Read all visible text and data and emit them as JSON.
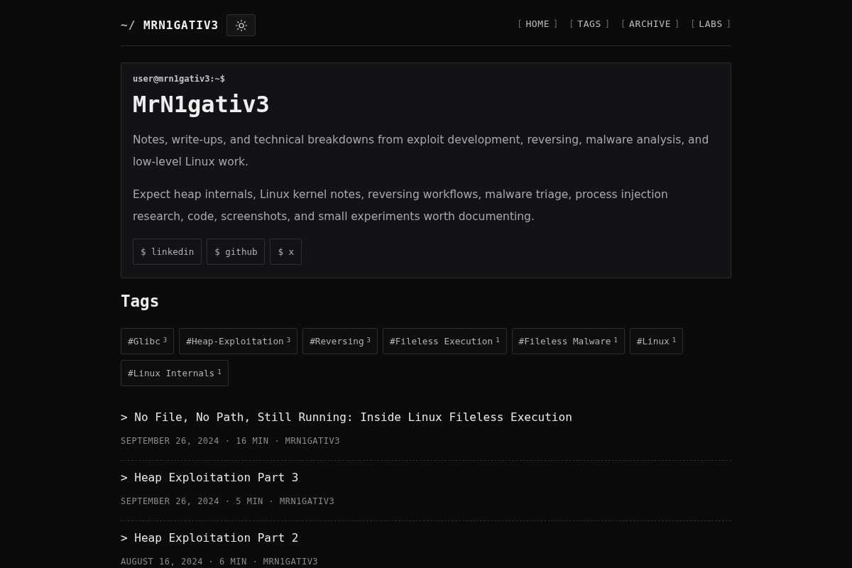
{
  "header": {
    "logo": {
      "prefix": "~/",
      "name": "MRN1GATIV3"
    },
    "nav": [
      {
        "open": "[",
        "label": "HOME",
        "close": "]"
      },
      {
        "open": "[",
        "label": "TAGS",
        "close": "]"
      },
      {
        "open": "[",
        "label": "ARCHIVE",
        "close": "]"
      },
      {
        "open": "[",
        "label": "LABS",
        "close": "]"
      }
    ]
  },
  "hero": {
    "prompt": "user@mrn1gativ3:~$",
    "title": "MrN1gativ3",
    "paragraphs": [
      "Notes, write-ups, and technical breakdowns from exploit development, reversing, malware analysis, and low-level Linux work.",
      "Expect heap internals, Linux kernel notes, reversing workflows, malware triage, process injection research, code, screenshots, and small experiments worth documenting."
    ],
    "links": [
      "$ linkedin",
      "$ github",
      "$ x"
    ]
  },
  "tags": {
    "heading": "Tags",
    "items": [
      {
        "label": "#Glibc",
        "count": "3"
      },
      {
        "label": "#Heap-Exploitation",
        "count": "3"
      },
      {
        "label": "#Reversing",
        "count": "3"
      },
      {
        "label": "#Fileless Execution",
        "count": "1"
      },
      {
        "label": "#Fileless Malware",
        "count": "1"
      },
      {
        "label": "#Linux",
        "count": "1"
      },
      {
        "label": "#Linux Internals",
        "count": "1"
      }
    ]
  },
  "posts": [
    {
      "title": "> No File, No Path, Still Running: Inside Linux Fileless Execution",
      "meta": "SEPTEMBER 26, 2024 · 16 MIN · MRN1GATIV3"
    },
    {
      "title": "> Heap Exploitation Part 3",
      "meta": "SEPTEMBER 26, 2024 · 5 MIN · MRN1GATIV3"
    },
    {
      "title": "> Heap Exploitation Part 2",
      "meta": "AUGUST 16, 2024 · 6 MIN · MRN1GATIV3"
    }
  ]
}
